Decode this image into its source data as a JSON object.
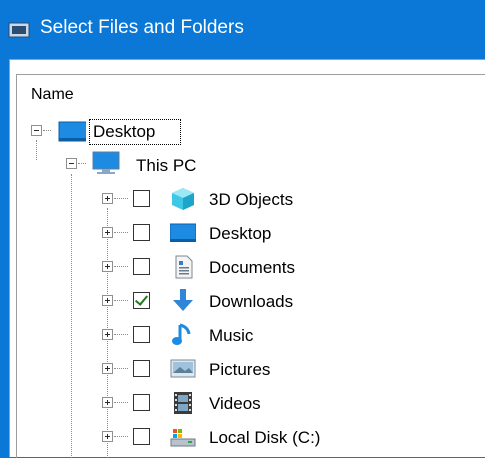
{
  "window": {
    "title": "Select Files and Folders"
  },
  "tree": {
    "column_header": "Name",
    "root": {
      "label": "Desktop",
      "expanded": true,
      "icon": "desktop-icon"
    },
    "this_pc": {
      "label": "This PC",
      "expanded": true,
      "icon": "computer-icon"
    },
    "items": [
      {
        "label": "3D Objects",
        "checked": false,
        "icon": "3d-objects-icon"
      },
      {
        "label": "Desktop",
        "checked": false,
        "icon": "desktop-icon"
      },
      {
        "label": "Documents",
        "checked": false,
        "icon": "documents-icon"
      },
      {
        "label": "Downloads",
        "checked": true,
        "icon": "downloads-icon"
      },
      {
        "label": "Music",
        "checked": false,
        "icon": "music-icon"
      },
      {
        "label": "Pictures",
        "checked": false,
        "icon": "pictures-icon"
      },
      {
        "label": "Videos",
        "checked": false,
        "icon": "videos-icon"
      },
      {
        "label": "Local Disk (C:)",
        "checked": false,
        "icon": "local-disk-icon"
      }
    ]
  },
  "colors": {
    "titlebar": "#0b78d7",
    "check": "#1f7a1f"
  }
}
